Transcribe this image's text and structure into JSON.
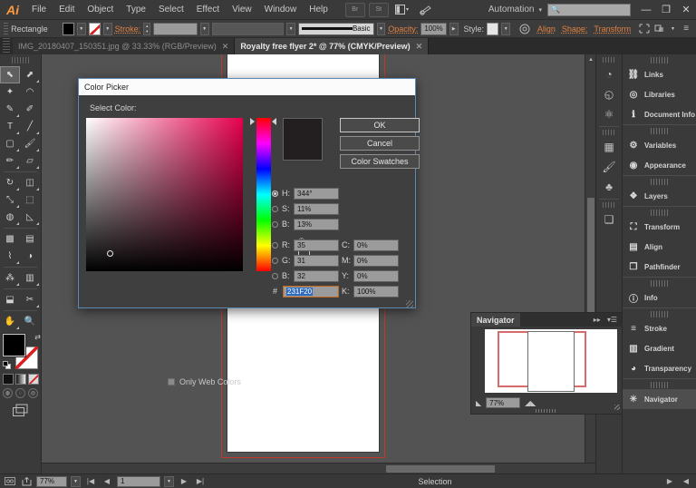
{
  "app": {
    "name": "Adobe Illustrator",
    "logo": "Ai"
  },
  "menubar": {
    "items": [
      "File",
      "Edit",
      "Object",
      "Type",
      "Select",
      "Effect",
      "View",
      "Window",
      "Help"
    ],
    "br_label": "Br",
    "st_label": "St",
    "arrange_icon": "layout-icon",
    "brush_icon": "brush-icon",
    "automation_label": "Automation",
    "automation_caret": "▾",
    "search_icon": "search-icon",
    "search_value": "",
    "minimize": "—",
    "restore": "❐",
    "close": "✕"
  },
  "controlbar": {
    "object_label": "Rectangle",
    "fill_swatch_color": "#000000",
    "stroke_swatch_color": "#ffffff",
    "stroke_link_label": "Stroke:",
    "stroke_weight_value": "",
    "stroke_style_value": "",
    "profile_label": "Basic",
    "opacity_link_label": "Opacity:",
    "opacity_value": "100%",
    "style_label": "Style:",
    "align_label": "Align",
    "shape_label": "Shape:",
    "transform_label": "Transform",
    "doc_setup_icon": "artboard-icon",
    "preferences_icon": "preferences-icon",
    "panel_menu_icon": "panel-menu-icon"
  },
  "tabs": [
    {
      "label": "IMG_20180407_150351.jpg @ 33.33% (RGB/Preview)",
      "active": false,
      "close": "✕"
    },
    {
      "label": "Royalty free flyer 2* @ 77% (CMYK/Preview)",
      "active": true,
      "close": "✕"
    }
  ],
  "toolbar": {
    "tools": [
      {
        "name": "selection-tool",
        "glyph": "⬉",
        "selected": true,
        "corner": false
      },
      {
        "name": "direct-selection-tool",
        "glyph": "⬈",
        "selected": false,
        "corner": true
      },
      {
        "name": "magic-wand-tool",
        "glyph": "✦",
        "selected": false,
        "corner": false
      },
      {
        "name": "lasso-tool",
        "glyph": "◠",
        "selected": false,
        "corner": false
      },
      {
        "name": "pen-tool",
        "glyph": "✎",
        "selected": false,
        "corner": true
      },
      {
        "name": "curvature-tool",
        "glyph": "✐",
        "selected": false,
        "corner": false
      },
      {
        "name": "type-tool",
        "glyph": "T",
        "selected": false,
        "corner": true
      },
      {
        "name": "line-segment-tool",
        "glyph": "╱",
        "selected": false,
        "corner": true
      },
      {
        "name": "rectangle-tool",
        "glyph": "▢",
        "selected": false,
        "corner": true
      },
      {
        "name": "paintbrush-tool",
        "glyph": "🖌",
        "selected": false,
        "corner": true
      },
      {
        "name": "pencil-tool",
        "glyph": "✏",
        "selected": false,
        "corner": true
      },
      {
        "name": "eraser-tool",
        "glyph": "▱",
        "selected": false,
        "corner": true
      },
      {
        "name": "rotate-tool",
        "glyph": "↻",
        "selected": false,
        "corner": true
      },
      {
        "name": "reflect-tool",
        "glyph": "◫",
        "selected": false,
        "corner": true
      },
      {
        "name": "scale-tool",
        "glyph": "⤡",
        "selected": false,
        "corner": true
      },
      {
        "name": "free-transform-tool",
        "glyph": "⬚",
        "selected": false,
        "corner": false
      },
      {
        "name": "shape-builder-tool",
        "glyph": "◍",
        "selected": false,
        "corner": true
      },
      {
        "name": "perspective-grid-tool",
        "glyph": "◺",
        "selected": false,
        "corner": true
      },
      {
        "name": "mesh-tool",
        "glyph": "▩",
        "selected": false,
        "corner": false
      },
      {
        "name": "gradient-tool",
        "glyph": "▤",
        "selected": false,
        "corner": false
      },
      {
        "name": "eyedropper-tool",
        "glyph": "⌇",
        "selected": false,
        "corner": true
      },
      {
        "name": "blend-tool",
        "glyph": "◑",
        "selected": false,
        "corner": false
      },
      {
        "name": "symbol-sprayer-tool",
        "glyph": "⁂",
        "selected": false,
        "corner": true
      },
      {
        "name": "column-graph-tool",
        "glyph": "▥",
        "selected": false,
        "corner": true
      },
      {
        "name": "artboard-tool",
        "glyph": "⬓",
        "selected": false,
        "corner": false
      },
      {
        "name": "slice-tool",
        "glyph": "✂",
        "selected": false,
        "corner": true
      },
      {
        "name": "hand-tool",
        "glyph": "✋",
        "selected": false,
        "corner": true
      },
      {
        "name": "zoom-tool",
        "glyph": "🔍",
        "selected": false,
        "corner": false
      }
    ],
    "fill_color": "#000000",
    "stroke_color": "#ffffff",
    "swap_icon": "swap-fill-stroke-icon",
    "default_icon": "default-fill-stroke-icon",
    "color_mode": "color-mode-icon",
    "gradient_mode": "gradient-mode-icon",
    "none_mode": "none-mode-icon",
    "draw_normal": "draw-normal-icon",
    "draw_behind": "draw-behind-icon",
    "draw_inside": "draw-inside-icon",
    "screen_mode": "screen-mode-icon"
  },
  "color_picker": {
    "title": "Color Picker",
    "select_label": "Select Color:",
    "preview_hex": "#231f20",
    "buttons": {
      "ok": "OK",
      "cancel": "Cancel",
      "swatches": "Color Swatches"
    },
    "fields": [
      {
        "name": "hue",
        "label": "H:",
        "value": "344°",
        "radio": true,
        "selected": true
      },
      {
        "name": "saturation",
        "label": "S:",
        "value": "11%",
        "radio": true,
        "selected": false
      },
      {
        "name": "brightness",
        "label": "B:",
        "value": "13%",
        "radio": true,
        "selected": false
      },
      {
        "name": "red",
        "label": "R:",
        "value": "35",
        "radio": true,
        "selected": false
      },
      {
        "name": "green",
        "label": "G:",
        "value": "31",
        "radio": true,
        "selected": false
      },
      {
        "name": "blue",
        "label": "B:",
        "value": "32",
        "radio": true,
        "selected": false
      }
    ],
    "cmyk": [
      {
        "name": "cyan",
        "label": "C:",
        "value": "0%"
      },
      {
        "name": "magenta",
        "label": "M:",
        "value": "0%"
      },
      {
        "name": "yellow",
        "label": "Y:",
        "value": "0%"
      },
      {
        "name": "black",
        "label": "K:",
        "value": "100%"
      }
    ],
    "hex_label": "#",
    "hex_value": "231F20",
    "only_web_colors": "Only Web Colors",
    "only_web_checked": false,
    "out_of_web_icon": "web-warning-icon"
  },
  "navigator": {
    "title": "Navigator",
    "collapse_icon": "collapse-icon",
    "menu_icon": "panel-menu-icon",
    "zoom_value": "77%",
    "zoom_out_icon": "zoom-out-icon",
    "zoom_in_icon": "zoom-in-icon"
  },
  "dock_mini": {
    "groups": [
      [
        {
          "name": "color-panel",
          "glyph": "◔"
        },
        {
          "name": "color-guide-panel",
          "glyph": "◵"
        },
        {
          "name": "edit-colors-panel",
          "glyph": "⚛"
        }
      ],
      [
        {
          "name": "swatches-panel",
          "glyph": "▦"
        },
        {
          "name": "brushes-panel",
          "glyph": "🖌"
        },
        {
          "name": "symbols-panel",
          "glyph": "♣"
        }
      ],
      [
        {
          "name": "artboards-panel",
          "glyph": "❏"
        }
      ]
    ]
  },
  "dock": {
    "groups": [
      [
        {
          "label": "Links",
          "icon": "links-icon",
          "glyph": "⛓",
          "active": false
        },
        {
          "label": "Libraries",
          "icon": "libraries-icon",
          "glyph": "◎",
          "active": false
        },
        {
          "label": "Document Info",
          "icon": "document-info-icon",
          "glyph": "ℹ",
          "active": false
        }
      ],
      [
        {
          "label": "Variables",
          "icon": "variables-icon",
          "glyph": "⚙",
          "active": false
        },
        {
          "label": "Appearance",
          "icon": "appearance-icon",
          "glyph": "◉",
          "active": false
        }
      ],
      [
        {
          "label": "Layers",
          "icon": "layers-icon",
          "glyph": "❖",
          "active": false
        }
      ],
      [
        {
          "label": "Transform",
          "icon": "transform-icon",
          "glyph": "⛶",
          "active": false
        },
        {
          "label": "Align",
          "icon": "align-icon",
          "glyph": "▤",
          "active": false
        },
        {
          "label": "Pathfinder",
          "icon": "pathfinder-icon",
          "glyph": "❐",
          "active": false
        }
      ],
      [
        {
          "label": "Info",
          "icon": "info-icon",
          "glyph": "ⓘ",
          "active": false
        }
      ],
      [
        {
          "label": "Stroke",
          "icon": "stroke-icon",
          "glyph": "≡",
          "active": false
        },
        {
          "label": "Gradient",
          "icon": "gradient-icon",
          "glyph": "▥",
          "active": false
        },
        {
          "label": "Transparency",
          "icon": "transparency-icon",
          "glyph": "◕",
          "active": false
        }
      ],
      [
        {
          "label": "Navigator",
          "icon": "navigator-icon",
          "glyph": "✳",
          "active": true
        }
      ]
    ]
  },
  "status": {
    "artboard_nav_icon": "artboard-nav-icon",
    "share_icon": "share-icon",
    "zoom_value": "77%",
    "first_icon": "first-artboard-icon",
    "prev_icon": "prev-artboard-icon",
    "page_value": "1",
    "next_icon": "next-artboard-icon",
    "last_icon": "last-artboard-icon",
    "tool_label": "Selection",
    "play_icon": "play-icon",
    "menu_icon": "status-menu-icon"
  }
}
